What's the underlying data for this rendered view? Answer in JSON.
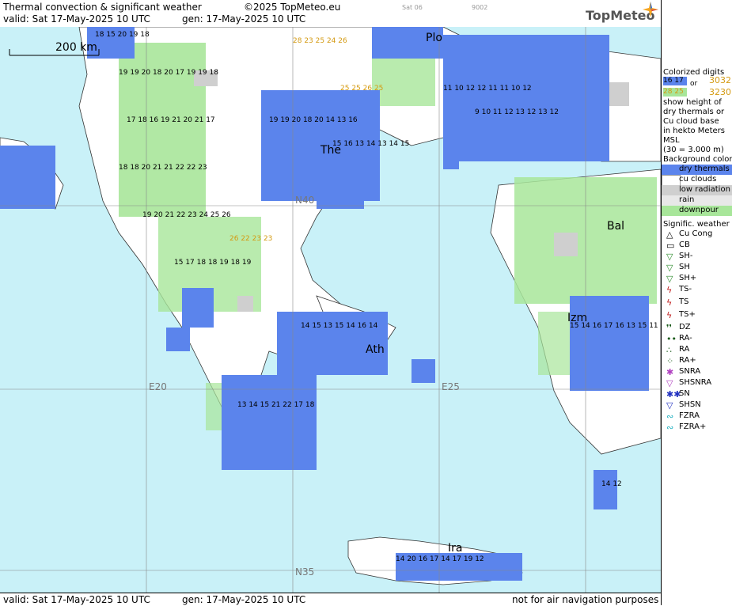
{
  "header": {
    "title": "Thermal convection & significant weather",
    "copyright": "©2025 TopMeteo.eu",
    "valid": "valid:  Sat  17-May-2025  10 UTC",
    "gen": "gen: 17-May-2025 10 UTC",
    "small1": "Sat 06",
    "small2": "9002",
    "logo": "TopMeteo"
  },
  "footer": {
    "valid": "valid:  Sat  17-May-2025  10 UTC",
    "gen": "gen: 17-May-2025 10 UTC",
    "note": "not for air navigation purposes"
  },
  "map": {
    "scale": "200 km",
    "cities": [
      "Plo",
      "The",
      "Bal",
      "Izm",
      "Ath",
      "Ira"
    ],
    "coords": [
      "E20",
      "E25",
      "N40",
      "N35"
    ]
  },
  "legend": {
    "colorized_title": "Colorized digits",
    "digits_a": "16 17",
    "digits_or": "or",
    "digits_b": "3032",
    "digits_c": "28 25",
    "digits_d": "3230",
    "desc1": "show height of",
    "desc2": "dry thermals or",
    "desc3": "Cu cloud base",
    "desc4": "in hekto Meters",
    "desc5": "MSL",
    "desc6": "(30 = 3.000 m)",
    "bg_title": "Background color",
    "bg_items": [
      "dry thermals",
      "cu clouds",
      "low radiation",
      "rain",
      "downpour"
    ],
    "bg_colors": [
      "#5b84ec",
      "#ffffff",
      "#cfcfcf",
      "#e8e8e8",
      "#a8e69a"
    ],
    "sig_title": "Signific. weather",
    "sig_items": [
      "Cu Cong",
      "CB",
      "SH-",
      "SH",
      "SH+",
      "TS-",
      "TS",
      "TS+",
      "DZ",
      "RA-",
      "RA",
      "RA+",
      "SNRA",
      "SHSNRA",
      "SN",
      "SHSN",
      "FZRA",
      "FZRA+"
    ]
  },
  "colors": {
    "sea": "#c9f1f8",
    "dry_thermals": "#5b84ec",
    "downpour": "#a8e69a",
    "low_radiation": "#cfcfcf"
  }
}
